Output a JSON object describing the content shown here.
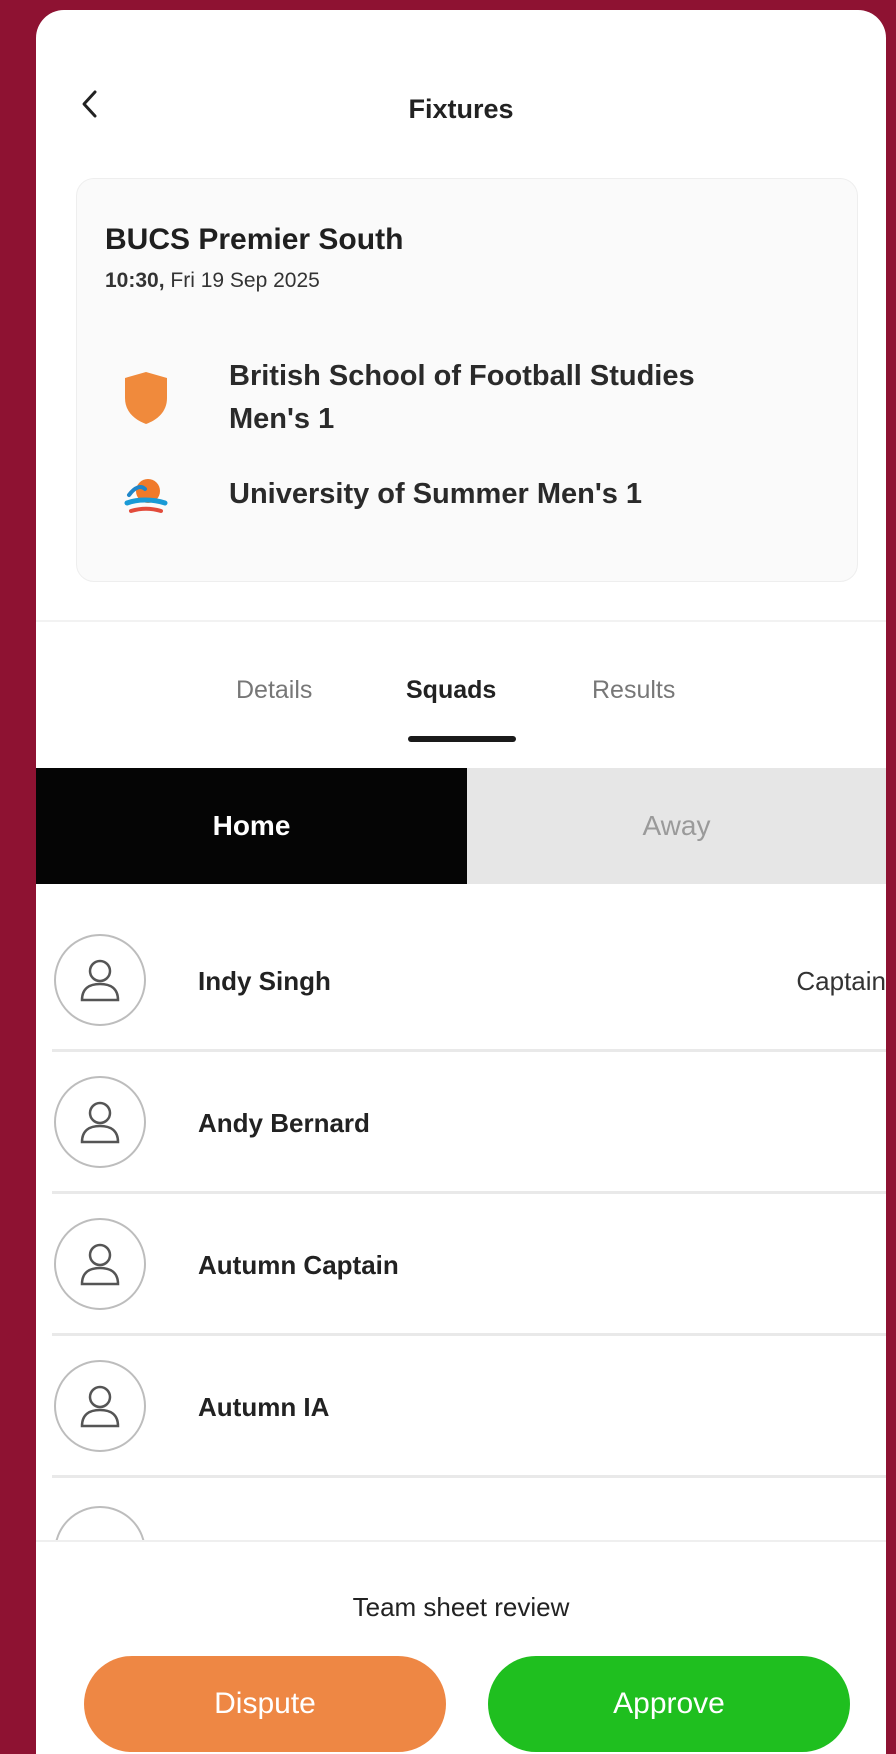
{
  "header": {
    "title": "Fixtures"
  },
  "fixture": {
    "competition": "BUCS Premier South",
    "time": "10:30,",
    "date": " Fri 19 Sep 2025",
    "home_team": {
      "name_line1": "British School of Football Studies",
      "name_line2": "Men's 1",
      "crest": "shield-icon",
      "crest_color": "#f08a3c"
    },
    "away_team": {
      "name": "University of Summer Men's 1",
      "crest": "sun-logo-icon"
    }
  },
  "tabs": [
    {
      "label": "Details",
      "active": false
    },
    {
      "label": "Squads",
      "active": true
    },
    {
      "label": "Results",
      "active": false
    }
  ],
  "segment": {
    "home_label": "Home",
    "away_label": "Away",
    "selected": "Home"
  },
  "squad": [
    {
      "name": "Indy Singh",
      "role": "Captain"
    },
    {
      "name": "Andy Bernard",
      "role": ""
    },
    {
      "name": "Autumn Captain",
      "role": ""
    },
    {
      "name": "Autumn IA",
      "role": ""
    }
  ],
  "footer": {
    "review_label": "Team sheet review",
    "dispute_label": "Dispute",
    "approve_label": "Approve"
  },
  "colors": {
    "brand_background": "#8e1232",
    "dispute": "#ee8744",
    "approve": "#1fbf1f"
  }
}
